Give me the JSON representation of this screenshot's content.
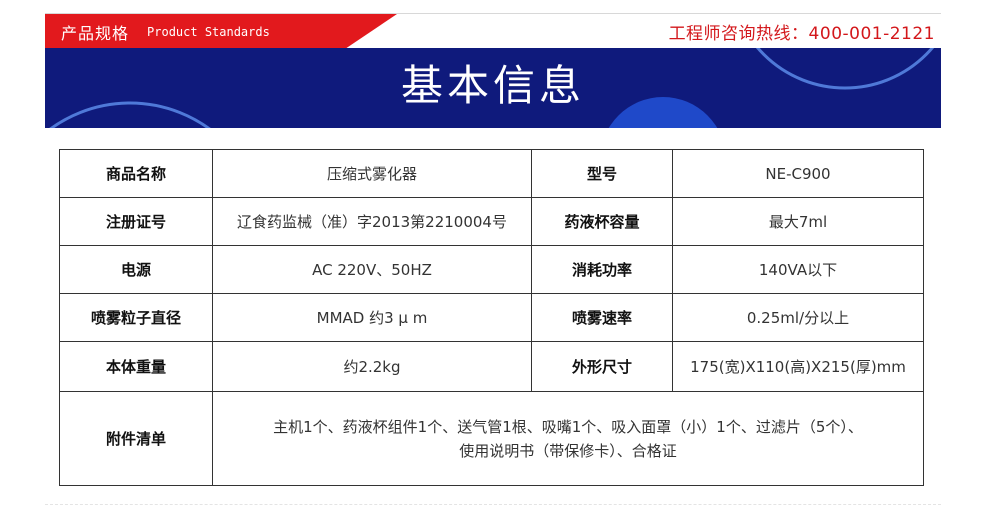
{
  "header": {
    "section_label_cn": "产品规格",
    "section_label_en": "Product Standards",
    "hotline": "工程师咨询热线：400-001-2121"
  },
  "banner": {
    "title": "基本信息"
  },
  "colors": {
    "tag_red": "#e2191d",
    "banner_navy": "#0f1a7c",
    "hotline_red": "#d3171b"
  },
  "specs": [
    {
      "k1": "商品名称",
      "v1": "压缩式雾化器",
      "k2": "型号",
      "v2": "NE-C900"
    },
    {
      "k1": "注册证号",
      "v1": "辽食药监械（准）字2013第2210004号",
      "k2": "药液杯容量",
      "v2": "最大7ml"
    },
    {
      "k1": "电源",
      "v1": "AC 220V、50HZ",
      "k2": "消耗功率",
      "v2": "140VA以下"
    },
    {
      "k1": "喷雾粒子直径",
      "v1": "MMAD 约3 μ m",
      "k2": "喷雾速率",
      "v2": "0.25ml/分以上"
    },
    {
      "k1": "本体重量",
      "v1": "约2.2kg",
      "k2": "外形尺寸",
      "v2": "175(宽)X110(高)X215(厚)mm"
    }
  ],
  "accessories": {
    "label": "附件清单",
    "line1": "主机1个、药液杯组件1个、送气管1根、吸嘴1个、吸入面罩（小）1个、过滤片（5个）、",
    "line2": "使用说明书（带保修卡）、合格证"
  }
}
